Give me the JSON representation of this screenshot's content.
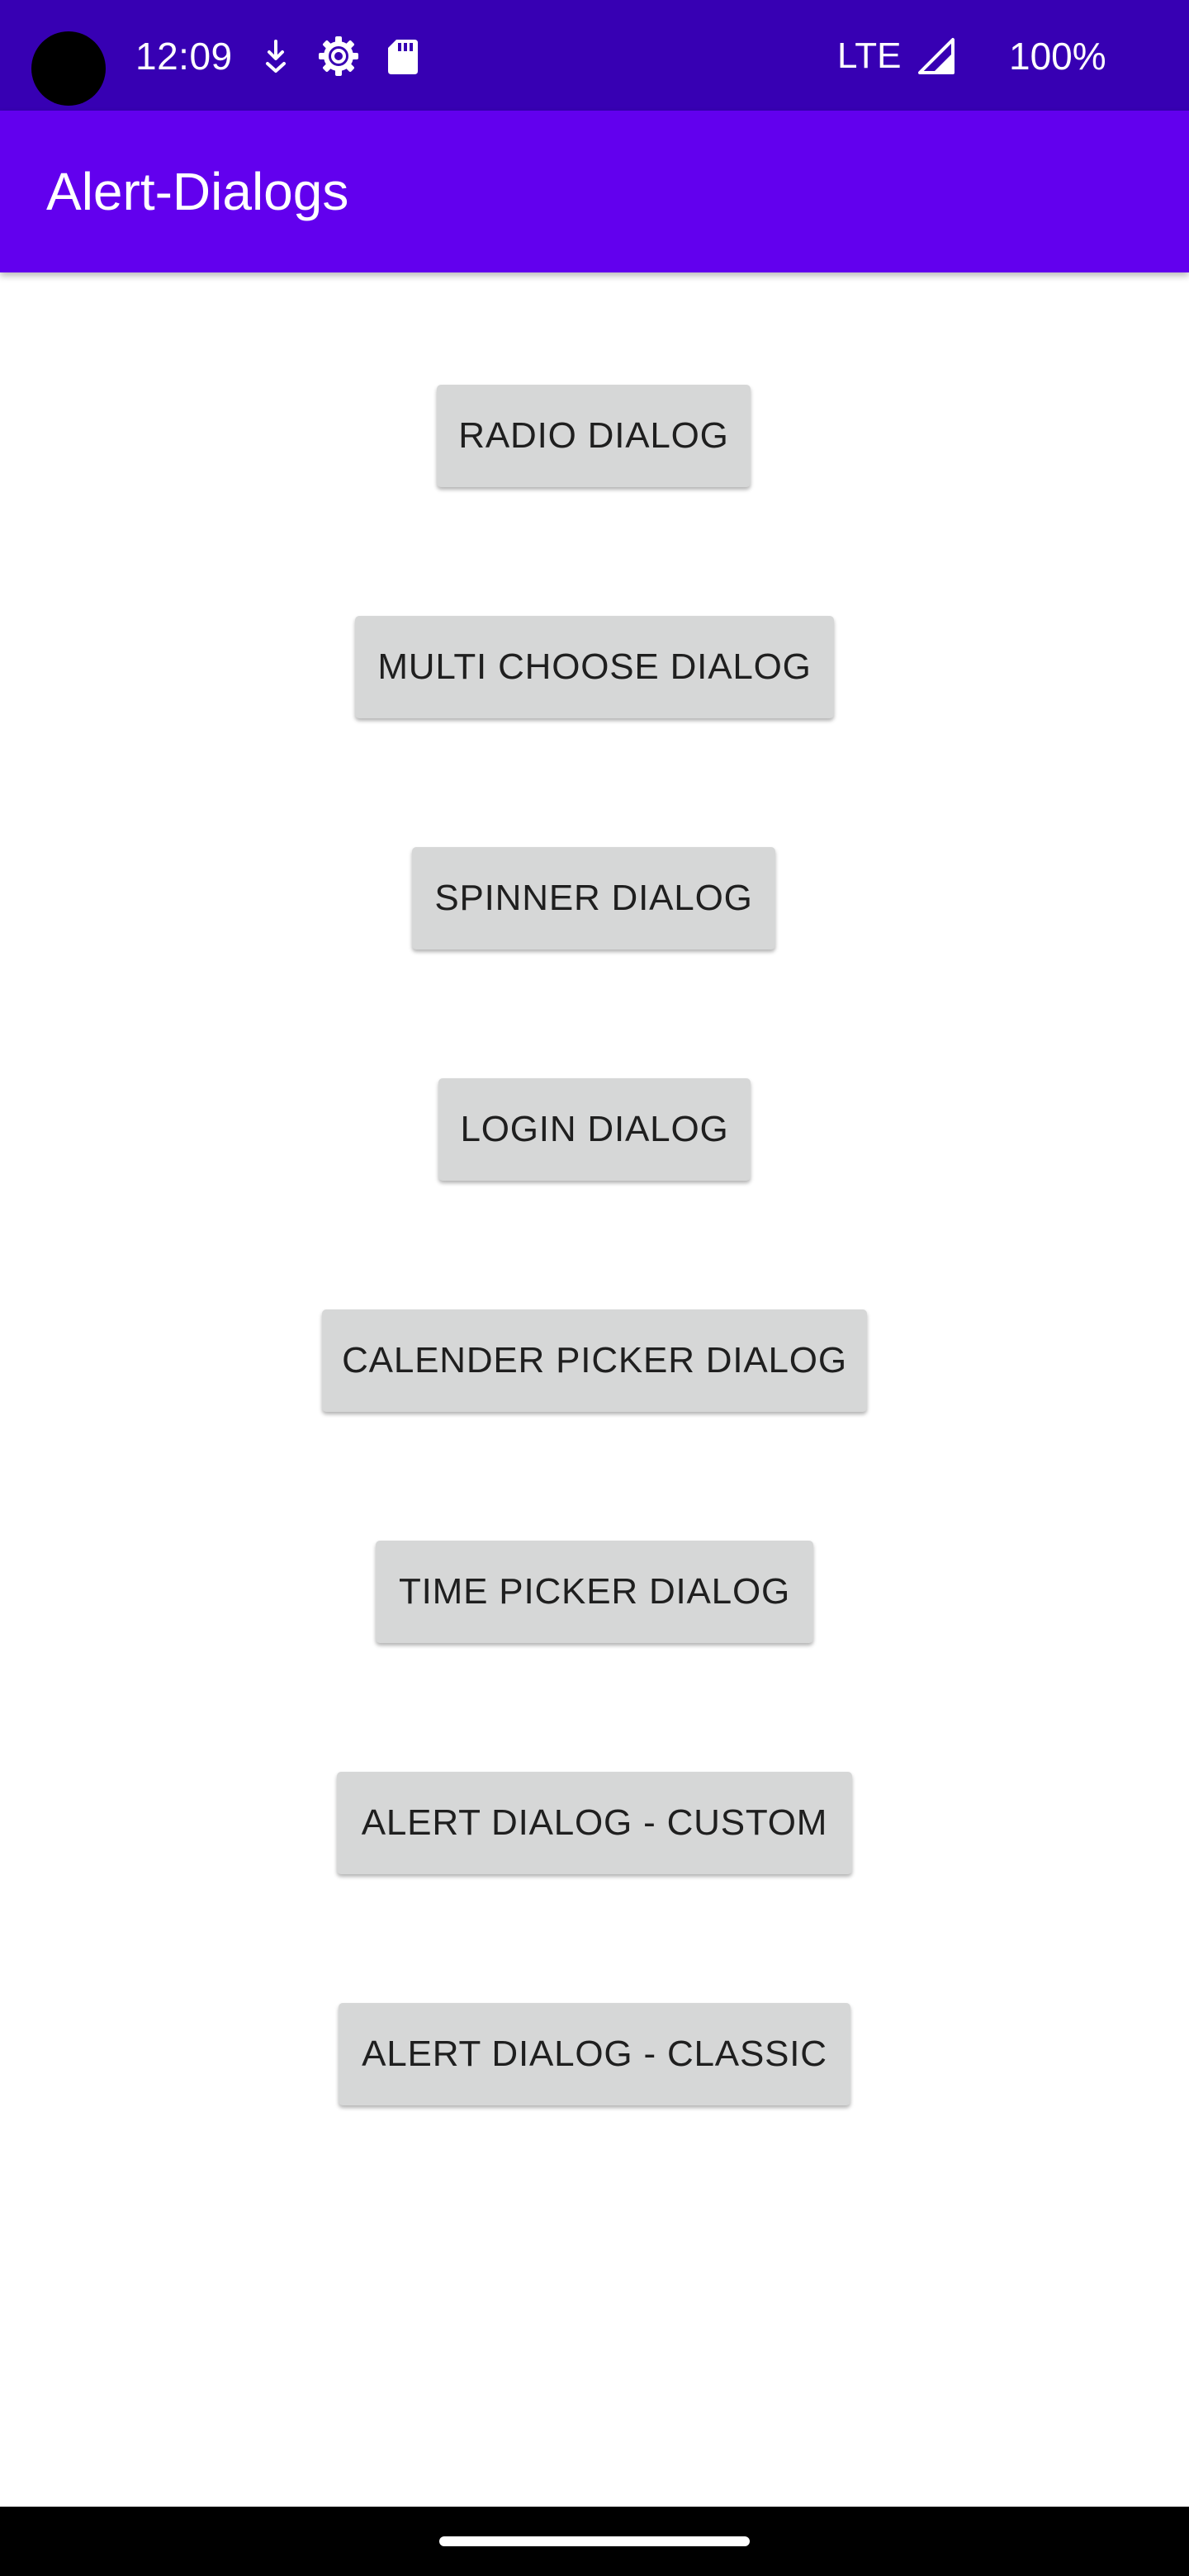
{
  "status_bar": {
    "time": "12:09",
    "network": "LTE",
    "battery": "100%",
    "icons": [
      "camera-cutout",
      "download-icon",
      "settings-gear-icon",
      "sd-card-icon",
      "signal-icon"
    ]
  },
  "app_bar": {
    "title": "Alert-Dialogs",
    "color": "#6200ee",
    "status_color": "#3700b3"
  },
  "buttons": [
    {
      "label": "RADIO DIALOG"
    },
    {
      "label": "MULTI CHOOSE DIALOG"
    },
    {
      "label": "SPINNER DIALOG"
    },
    {
      "label": "LOGIN DIALOG"
    },
    {
      "label": "CALENDER PICKER DIALOG"
    },
    {
      "label": "TIME PICKER DIALOG"
    },
    {
      "label": "ALERT DIALOG - CUSTOM"
    },
    {
      "label": "ALERT DIALOG - CLASSIC"
    }
  ],
  "colors": {
    "button_bg": "#d6d7d7",
    "button_text": "#1f1f1f",
    "background": "#ffffff"
  }
}
